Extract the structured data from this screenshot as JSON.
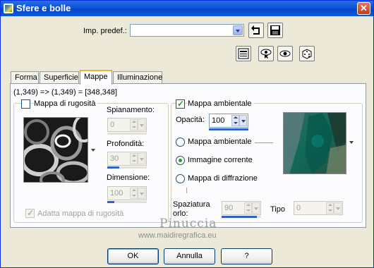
{
  "window": {
    "title": "Sfere e bolle",
    "close_label": "✕"
  },
  "preset": {
    "label": "Imp. predef.:",
    "value": ""
  },
  "tabs": [
    "Forma",
    "Superficie",
    "Mappe",
    "Illuminazione"
  ],
  "active_tab": "Mappe",
  "coords_text": "(1,349) => (1,349) = [348,348]",
  "bump": {
    "checkbox_label": "Mappa di rugosità",
    "checked": false,
    "smoothing_label": "Spianamento:",
    "smoothing_value": "0",
    "depth_label": "Profondità:",
    "depth_value": "30",
    "size_label": "Dimensione:",
    "size_value": "100",
    "fit_label": "Adatta mappa di rugosità",
    "fit_checked": true
  },
  "env": {
    "checkbox_label": "Mappa ambientale",
    "checked": true,
    "opacity_label": "Opacità:",
    "opacity_value": "100",
    "opacity_fraction": 1.0,
    "radio_env_label": "Mappa ambientale",
    "radio_current_label": "Immagine corrente",
    "radio_diff_label": "Mappa di diffrazione",
    "selected_radio": "Immagine corrente",
    "spacing_label_1": "Spaziatura",
    "spacing_label_2": "orlo:",
    "spacing_value": "90",
    "type_label": "Tipo",
    "type_value": "0"
  },
  "watermark": {
    "line1": "Pinuccia",
    "line2": "www.maidiregrafica.eu"
  },
  "buttons": {
    "ok": "OK",
    "cancel": "Annulla",
    "help": "?"
  },
  "colors": {
    "titlebar": "#0a54d8",
    "window_bg": "#ece9d8",
    "accent_tab": "#f0b030",
    "check_green": "#21a121",
    "bar_fill": "#3262c8"
  }
}
